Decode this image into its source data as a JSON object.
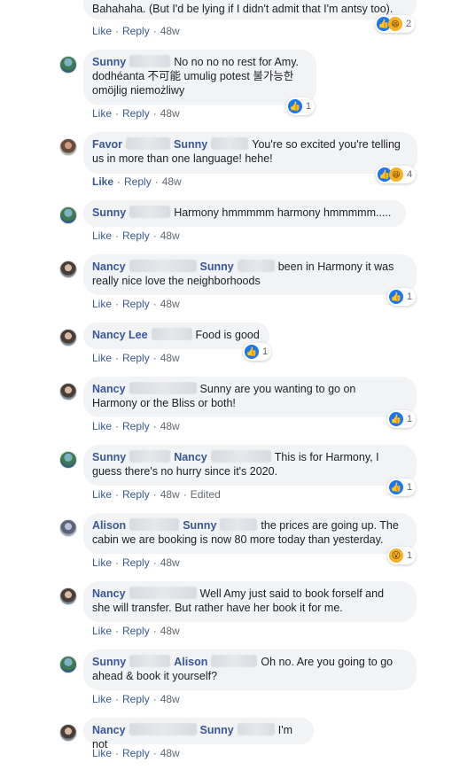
{
  "actions": {
    "like": "Like",
    "reply": "Reply",
    "sep": "·",
    "edited": "Edited"
  },
  "icons": {
    "like": "thumbs-up-icon",
    "haha": "haha-face-icon",
    "wow": "wow-face-icon"
  },
  "colors": {
    "name": "#385898",
    "bubble": "#f2f3f5",
    "like_blue": "#1877f2",
    "haha_yellow": "#f7b125"
  },
  "comments": [
    {
      "text": "Bahahaha. (But I'd be lying if I didn't admit that I'm antsy too).",
      "time": "48w",
      "reactions": "2"
    },
    {
      "name": "Sunny",
      "text": "No no no no rest for Amy.",
      "text2": "dodhéanta 不可能 umulig potest 불가능한",
      "text3": "omöjlig niemożliwy",
      "time": "48w",
      "reactions": "1"
    },
    {
      "name": "Favor",
      "mention": "Sunny",
      "text": "You're so excited you're telling",
      "text2": "us in more than one language! hehe!",
      "time": "48w",
      "reactions": "4"
    },
    {
      "name": "Sunny",
      "text": "Harmony hmmmmm harmony hmmmmm.....",
      "time": "48w"
    },
    {
      "name": "Nancy",
      "mention": "Sunny",
      "text": "been in Harmony it was",
      "text2": "really nice love the neighborhoods",
      "time": "48w",
      "reactions": "1"
    },
    {
      "name": "Nancy Lee",
      "text": "Food is good",
      "time": "48w",
      "reactions": "1"
    },
    {
      "name": "Nancy",
      "text": "Sunny are you wanting to go on",
      "text2": "Harmony or the Bliss or both!",
      "time": "48w",
      "reactions": "1"
    },
    {
      "name": "Sunny",
      "mention": "Nancy",
      "text": "This is for Harmony, I",
      "text2": "guess there's no hurry since it's 2020.",
      "time": "48w",
      "reactions": "1"
    },
    {
      "name": "Alison",
      "mention": "Sunny",
      "text": "the prices are going up. The",
      "text2": "cabin we are booking is now 80 more today than yesterday.",
      "time": "48w",
      "reactions": "1"
    },
    {
      "name": "Nancy",
      "text": "Well Amy just said to book forself and",
      "text2": "she will transfer. But rather have her book it for me.",
      "time": "48w"
    },
    {
      "name": "Sunny",
      "mention": "Alison",
      "text": "Oh no. Are you going to go",
      "text2": "ahead & book it yourself?",
      "time": "48w"
    },
    {
      "name": "Nancy",
      "mention": "Sunny",
      "text": "I'm not",
      "time": "48w"
    }
  ]
}
